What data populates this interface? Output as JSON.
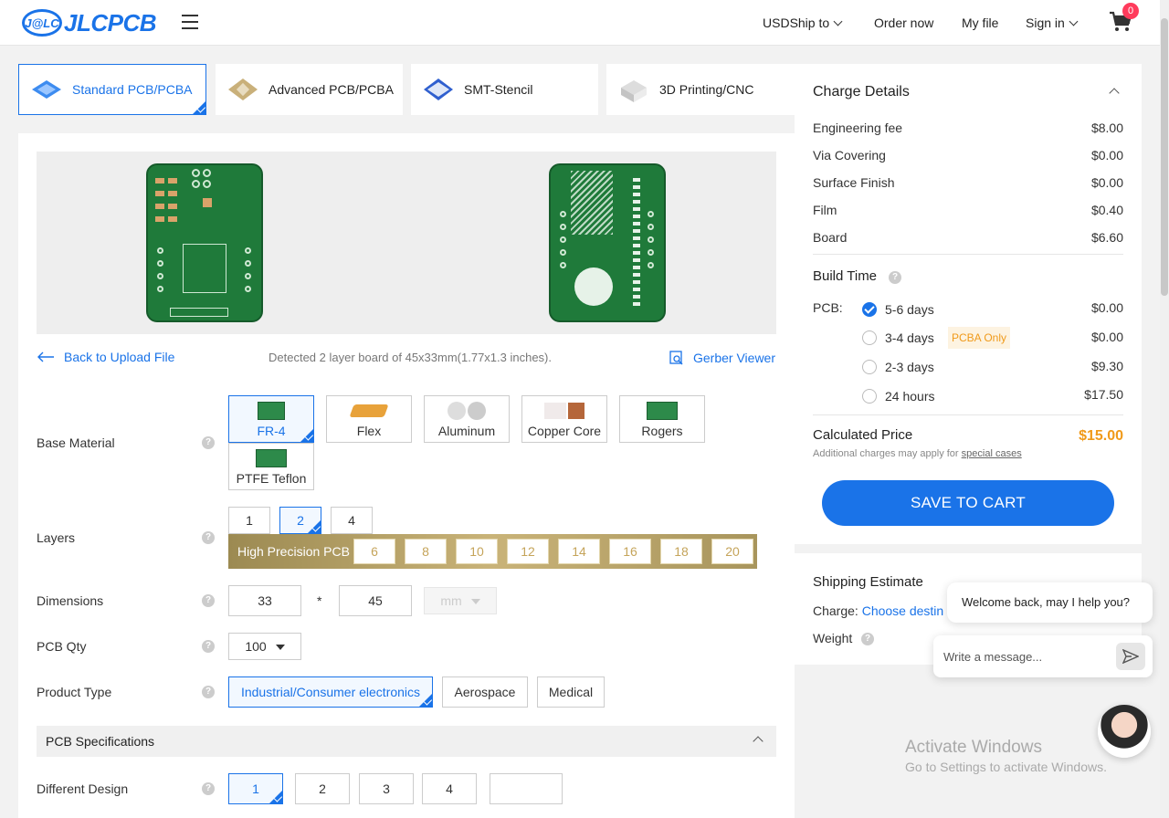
{
  "header": {
    "logo_mark": "J@LC",
    "logo_text": "JLCPCB",
    "nav": {
      "currency": "USD",
      "ship_to": "Ship to",
      "order_now": "Order now",
      "my_file": "My file",
      "sign_in": "Sign in"
    },
    "cart_count": "0"
  },
  "product_tabs": [
    {
      "label": "Standard PCB/PCBA",
      "active": true
    },
    {
      "label": "Advanced PCB/PCBA",
      "active": false
    },
    {
      "label": "SMT-Stencil",
      "active": false
    },
    {
      "label": "3D Printing/CNC",
      "active": false
    }
  ],
  "upload": {
    "back_label": "Back to Upload File",
    "detected": "Detected 2 layer board of 45x33mm(1.77x1.3 inches).",
    "gerber_viewer": "Gerber Viewer"
  },
  "form": {
    "base_material": {
      "label": "Base Material",
      "options": [
        "FR-4",
        "Flex",
        "Aluminum",
        "Copper Core",
        "Rogers",
        "PTFE Teflon"
      ],
      "selected": "FR-4"
    },
    "layers": {
      "label": "Layers",
      "options": [
        "1",
        "2",
        "4"
      ],
      "selected": "2",
      "high_precision_label": "High Precision PCB",
      "high_precision_options": [
        "6",
        "8",
        "10",
        "12",
        "14",
        "16",
        "18",
        "20"
      ]
    },
    "dimensions": {
      "label": "Dimensions",
      "width": "33",
      "separator": "*",
      "height": "45",
      "unit": "mm"
    },
    "pcb_qty": {
      "label": "PCB Qty",
      "value": "100"
    },
    "product_type": {
      "label": "Product Type",
      "options": [
        "Industrial/Consumer electronics",
        "Aerospace",
        "Medical"
      ],
      "selected": "Industrial/Consumer electronics"
    },
    "specs_title": "PCB Specifications",
    "different_design": {
      "label": "Different Design",
      "options": [
        "1",
        "2",
        "3",
        "4"
      ],
      "selected": "1"
    }
  },
  "charge": {
    "title": "Charge Details",
    "fees": [
      {
        "name": "Engineering fee",
        "price": "$8.00"
      },
      {
        "name": "Via Covering",
        "price": "$0.00"
      },
      {
        "name": "Surface Finish",
        "price": "$0.00"
      },
      {
        "name": "Film",
        "price": "$0.40"
      },
      {
        "name": "Board",
        "price": "$6.60"
      }
    ],
    "build_time_title": "Build Time",
    "pcb_label": "PCB:",
    "build_options": [
      {
        "label": "5-6 days",
        "price": "$0.00",
        "selected": true
      },
      {
        "label": "3-4 days",
        "price": "$0.00",
        "selected": false,
        "badge": "PCBA Only"
      },
      {
        "label": "2-3 days",
        "price": "$9.30",
        "selected": false
      },
      {
        "label": "24 hours",
        "price": "$17.50",
        "selected": false
      }
    ],
    "calculated_label": "Calculated Price",
    "calculated_price": "$15.00",
    "additional_note": "Additional charges may apply for",
    "special_cases": "special cases",
    "save_button": "SAVE TO CART"
  },
  "shipping": {
    "title": "Shipping Estimate",
    "charge_label": "Charge:",
    "charge_link": "Choose destin",
    "weight_label": "Weight"
  },
  "chat": {
    "welcome": "Welcome back, may I help you?",
    "placeholder": "Write a message..."
  },
  "watermark": {
    "line1": "Activate Windows",
    "line2": "Go to Settings to activate Windows."
  },
  "colors": {
    "accent": "#1a73e8",
    "price_highlight": "#f09a1a",
    "badge": "#ff3b5c"
  }
}
